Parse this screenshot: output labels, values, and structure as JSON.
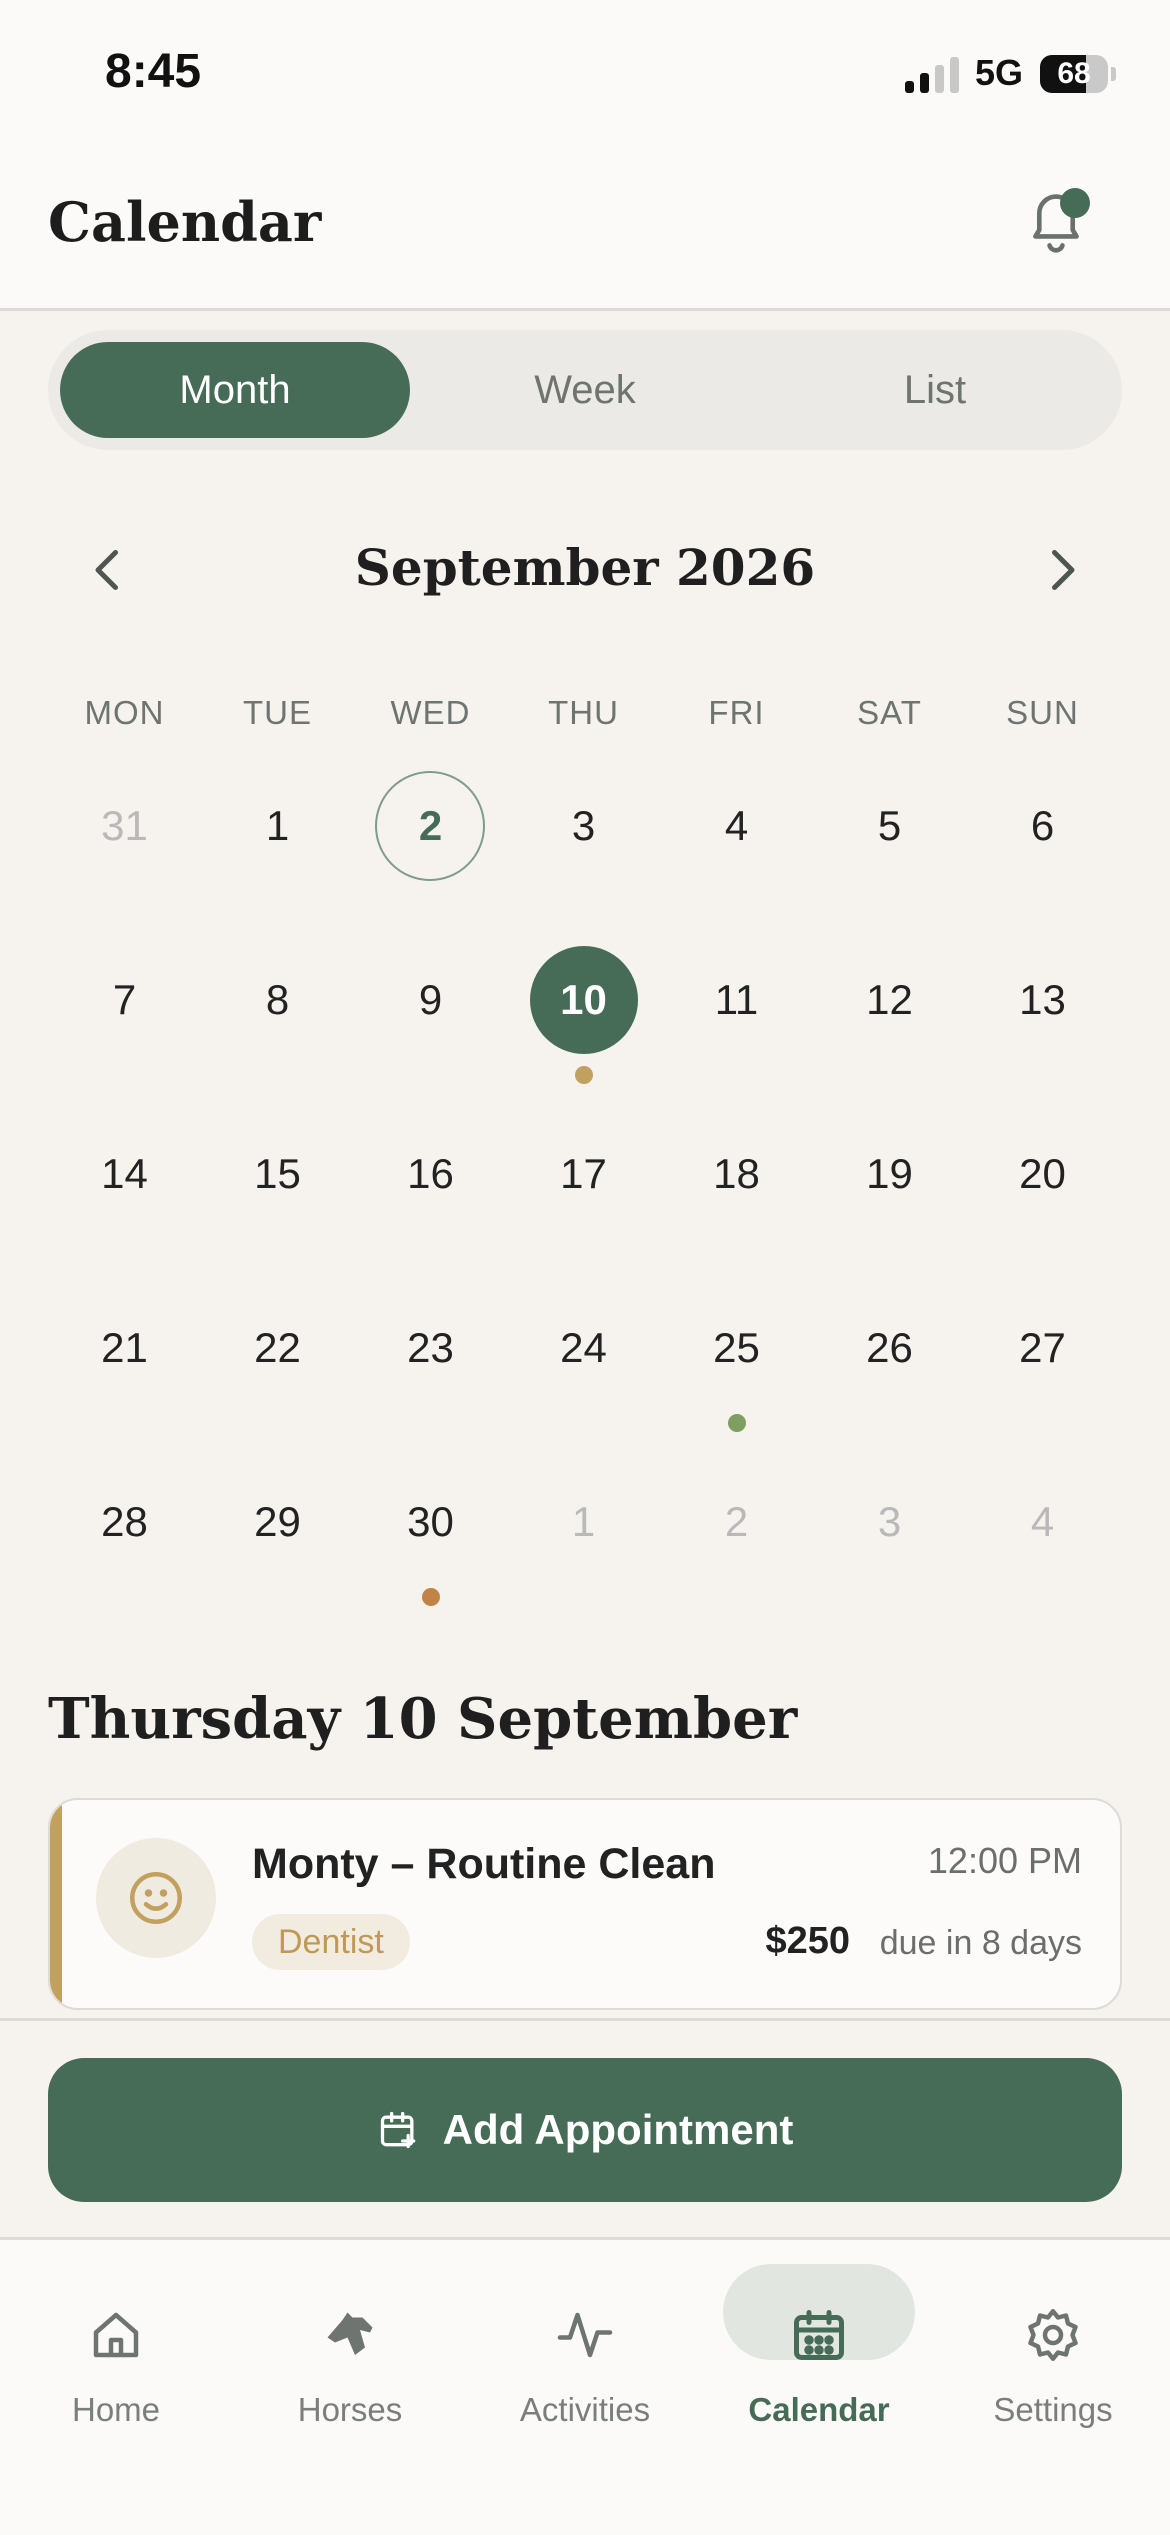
{
  "status_bar": {
    "time": "8:45",
    "network": "5G",
    "battery": "68",
    "battery_level": 0.68
  },
  "header": {
    "title": "Calendar"
  },
  "view_toggle": {
    "options": [
      "Month",
      "Week",
      "List"
    ],
    "selected": "Month"
  },
  "calendar": {
    "month_label": "September 2026",
    "weekdays": [
      "MON",
      "TUE",
      "WED",
      "THU",
      "FRI",
      "SAT",
      "SUN"
    ],
    "weeks": [
      [
        "31",
        "1",
        "2",
        "3",
        "4",
        "5",
        "6"
      ],
      [
        "7",
        "8",
        "9",
        "10",
        "11",
        "12",
        "13"
      ],
      [
        "14",
        "15",
        "16",
        "17",
        "18",
        "19",
        "20"
      ],
      [
        "21",
        "22",
        "23",
        "24",
        "25",
        "26",
        "27"
      ],
      [
        "28",
        "29",
        "30",
        "1",
        "2",
        "3",
        "4"
      ]
    ],
    "today": "2",
    "selected": "10",
    "event_dot_colors": {
      "gold": "#c2a060",
      "green": "#7f9e61",
      "orange": "#c08447"
    }
  },
  "selected_day": {
    "heading": "Thursday 10 September",
    "appointment": {
      "title": "Monty – Routine Clean",
      "category": "Dentist",
      "time": "12:00 PM",
      "amount": "$250",
      "due": "due in 8 days",
      "icon": "smile-icon"
    }
  },
  "actions": {
    "add_appointment": "Add Appointment"
  },
  "tab_bar": {
    "items": [
      {
        "label": "Home",
        "icon": "home-icon"
      },
      {
        "label": "Horses",
        "icon": "horse-icon"
      },
      {
        "label": "Activities",
        "icon": "activity-icon"
      },
      {
        "label": "Calendar",
        "icon": "calendar-icon"
      },
      {
        "label": "Settings",
        "icon": "gear-icon"
      }
    ],
    "active": "Calendar"
  },
  "colors": {
    "primary": "#466c58",
    "accent_gold": "#c2a060",
    "background": "#f6f3ef"
  }
}
